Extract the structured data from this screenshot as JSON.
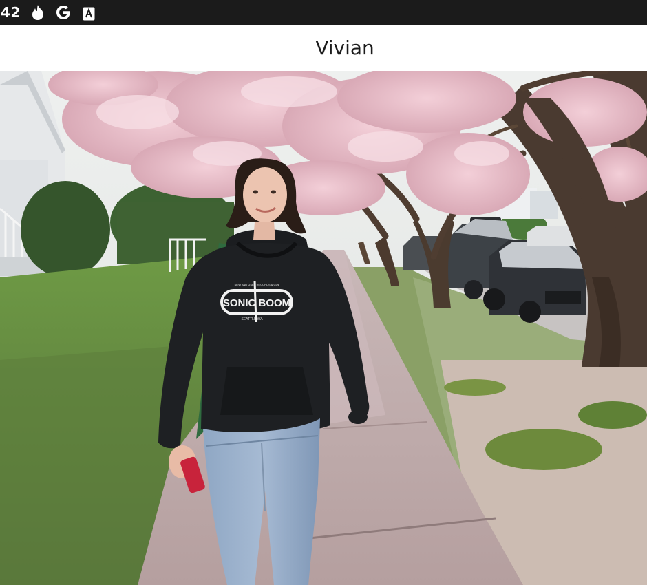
{
  "status_bar": {
    "time": "42",
    "icons": [
      "flame-icon",
      "google-icon",
      "translate-a-icon"
    ]
  },
  "header": {
    "title": "Vivian"
  },
  "photo": {
    "sweatshirt_brand": "SONIC BOOM",
    "sweatshirt_top_text": "NEW AND USED RECORDS & CDs",
    "sweatshirt_bottom_text": "SEATTLE WA"
  },
  "colors": {
    "status_bar_bg": "#1b1b1b",
    "header_bg": "#ffffff",
    "title_color": "#1c1c1c"
  }
}
